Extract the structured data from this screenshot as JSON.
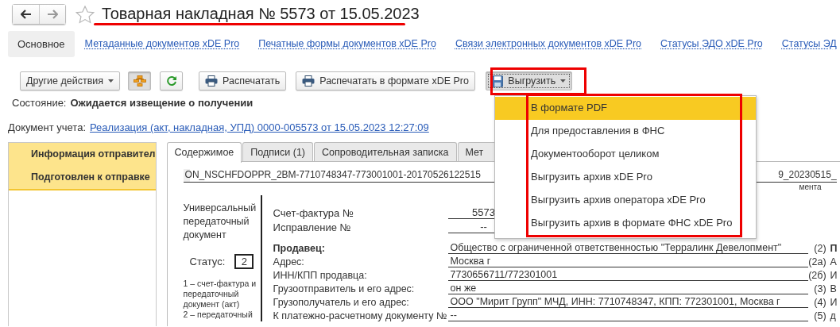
{
  "history_buttons": [
    {
      "kind": "back",
      "disabled": false
    },
    {
      "kind": "forward",
      "disabled": true
    }
  ],
  "favorite": {
    "on": false
  },
  "title": "Товарная накладная № 5573 от 15.05.2023",
  "sections": [
    {
      "label": "Основное",
      "selected": true
    },
    {
      "label": "Метаданные документов xDE Pro",
      "selected": false
    },
    {
      "label": "Печатные формы документов xDE Pro",
      "selected": false
    },
    {
      "label": "Связи электронных документов xDE Pro",
      "selected": false
    },
    {
      "label": "Статусы ЭДО xDE Pro",
      "selected": false
    },
    {
      "label": "Статусы ЭД",
      "selected": false
    }
  ],
  "toolbar": [
    {
      "kind": "dropdown",
      "label": "Другие действия",
      "pressed": false
    },
    {
      "kind": "structure",
      "pressed": true
    },
    {
      "kind": "refresh",
      "pressed": false
    },
    {
      "kind": "print",
      "label": "Распечатать",
      "pressed": false
    },
    {
      "kind": "print",
      "label": "Распечатать в формате xDE Pro",
      "pressed": false
    },
    {
      "kind": "export",
      "label": "Выгрузить",
      "pressed": true
    }
  ],
  "state": {
    "label": "Состояние:",
    "value": "Ожидается извещение о получении"
  },
  "accounting_document": {
    "label": "Документ учета:",
    "link": "Реализация (акт, накладная, УПД) 0000-005573 от 15.05.2023 12:27:09"
  },
  "sidebar": {
    "items": [
      {
        "label": "Информация отправител",
        "selected": true
      },
      {
        "label": "Подготовлен к отправке",
        "selected": true
      }
    ]
  },
  "tabs": [
    {
      "label": "Содержимое",
      "selected": true
    },
    {
      "label": "Подписи (1)",
      "selected": false
    },
    {
      "label": "Сопроводительная записка",
      "selected": false
    },
    {
      "label": "Мет",
      "selected": false
    }
  ],
  "document": {
    "file_name": "ON_NSCHFDOPPR_2BM-7710748347-773001001-20170526122515",
    "file_name_tail": "9_20230515_",
    "file_caption_tail": "мента",
    "form_title": "Универсальный передаточный документ",
    "status_label": "Статус:",
    "status_value": "2",
    "status_notes": [
      "1 – счет-фактура и передаточный документ (акт)",
      "2 – передаточный"
    ],
    "header_fields": [
      {
        "label": "Счет-фактура №",
        "value": "5573"
      },
      {
        "label": "Исправление №",
        "value": "--"
      }
    ],
    "rows": [
      {
        "kind": "heading",
        "label": "Продавец:",
        "value": "Общество с ограниченной ответственностью \"Терралинк Девелопмент\"",
        "code": "(2)",
        "next_column": "П"
      },
      {
        "kind": "field",
        "label": "Адрес:",
        "value": "Москва г",
        "code": "(2а)",
        "next_column": "А"
      },
      {
        "kind": "field",
        "label": "ИНН/КПП продавца:",
        "value": "7730656711/772301001",
        "code": "(2б)",
        "next_column": "И"
      },
      {
        "kind": "field",
        "label": "Грузоотправитель и его адрес:",
        "value": "он же",
        "code": "(3)",
        "next_column": "В"
      },
      {
        "kind": "field",
        "label": "Грузополучатель и его адрес:",
        "value": "ООО \"Мирит Групп\" МЧД, ИНН: 7710748347, КПП: 772301001, Москва г",
        "code": "(4)",
        "next_column": "И"
      },
      {
        "kind": "field",
        "label": "К платежно-расчетному документу №",
        "value": "--",
        "code": "(5)",
        "next_column": "д"
      }
    ]
  },
  "export_menu": {
    "items": [
      {
        "label": "В формате PDF",
        "selected": true
      },
      {
        "label": "Для предоставления в ФНС",
        "selected": false
      },
      {
        "label": "Документооборот целиком",
        "selected": false
      },
      {
        "label": "Выгрузить архив xDE Pro",
        "selected": false
      },
      {
        "label": "Выгрузить архив оператора xDE Pro",
        "selected": false
      },
      {
        "label": "Выгрузить архив в формате ФНС xDE Pro",
        "selected": false
      }
    ]
  },
  "annotations": [
    {
      "kind": "title-underline"
    },
    {
      "kind": "button-frame"
    },
    {
      "kind": "menu-frame"
    }
  ]
}
